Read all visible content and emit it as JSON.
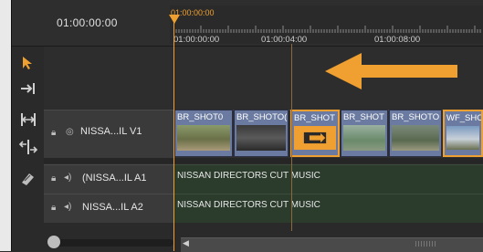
{
  "header": {
    "timecode": "01:00:00:00",
    "ruler_top_label": "01:00:00:00",
    "ruler_labels": [
      "01:00:00:00",
      "01:00:04:00",
      "01:00:08:00"
    ]
  },
  "tools": [
    {
      "icon": "selection-tool-icon"
    },
    {
      "icon": "track-select-icon"
    },
    {
      "icon": "ripple-edit-icon"
    },
    {
      "icon": "rolling-edit-icon"
    },
    {
      "icon": "razor-tool-icon"
    }
  ],
  "tracks": {
    "v1": {
      "label": "NISSA...IL V1"
    },
    "a1": {
      "label": "(NISSA...IL A1"
    },
    "a2": {
      "label": "NISSA...IL A2"
    }
  },
  "clips": [
    {
      "label": "BR_SHOT0"
    },
    {
      "label": "BR_SHOTO("
    },
    {
      "label": "BR_SHOT"
    },
    {
      "label": "BR_SHOT"
    },
    {
      "label": "BR_SHOTO"
    },
    {
      "label": "WF_SHO"
    }
  ],
  "audio": {
    "a1_clip": "NISSAN DIRECTORS CUT MUSIC",
    "a2_clip": "NISSAN DIRECTORS CUT MUSIC"
  },
  "colors": {
    "accent": "#f0a030",
    "clip": "#6a7aa0",
    "audio_track": "#2b3b2c"
  }
}
